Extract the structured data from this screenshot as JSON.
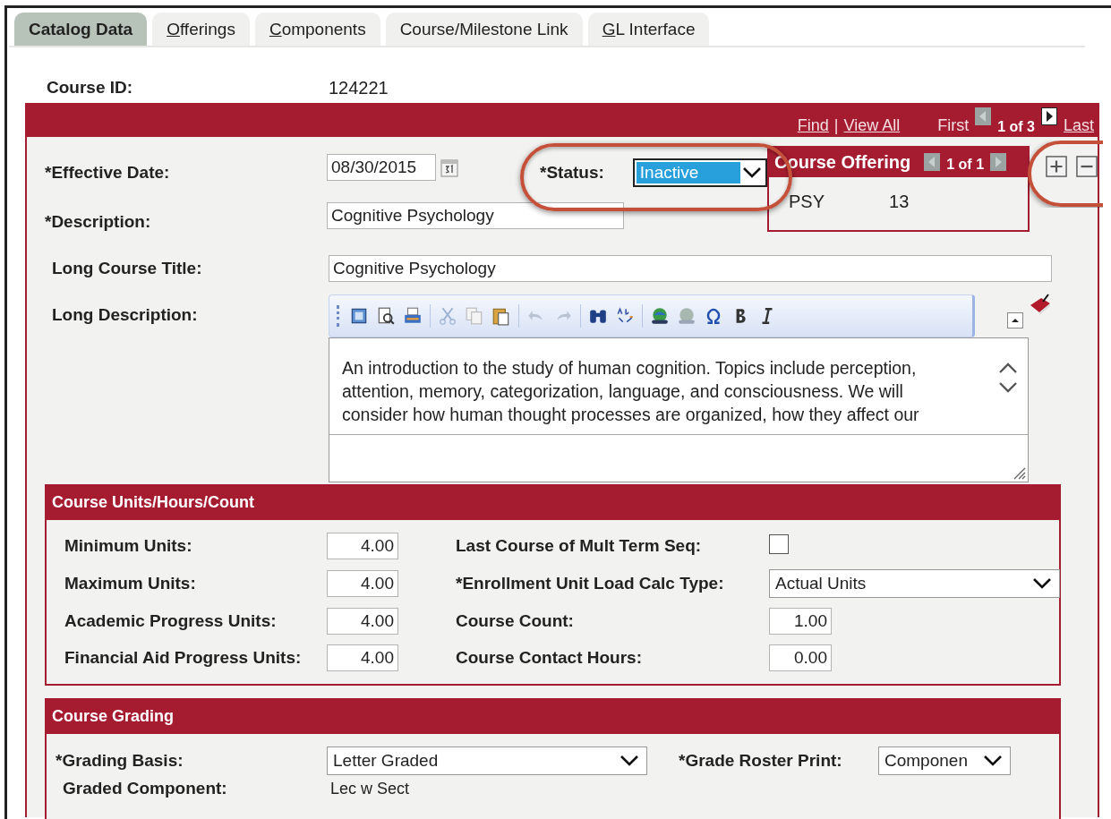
{
  "tabs": [
    {
      "label": "Catalog Data",
      "underline_first": false,
      "selected": true
    },
    {
      "label": "Offerings",
      "underline_first": true,
      "selected": false
    },
    {
      "label": "Components",
      "underline_first": true,
      "selected": false
    },
    {
      "label": "Course/Milestone Link",
      "underline_first": false,
      "selected": false
    },
    {
      "label": "GL Interface",
      "underline_first": true,
      "selected": false
    }
  ],
  "course_id": {
    "label": "Course ID:",
    "value": "124221"
  },
  "nav": {
    "find": "Find",
    "separator": "|",
    "view_all": "View All",
    "first": "First",
    "position": "1 of 3",
    "last": "Last"
  },
  "effective_date": {
    "label": "*Effective Date:",
    "value": "08/30/2015"
  },
  "status": {
    "label": "*Status:",
    "value": "Inactive",
    "circled": true
  },
  "course_offering": {
    "title": "Course Offering",
    "position": "1 of 1",
    "subject": "PSY",
    "number": "13"
  },
  "row_buttons": {
    "circled": true
  },
  "description": {
    "label": "*Description:",
    "value": "Cognitive Psychology"
  },
  "long_title": {
    "label": "Long Course Title:",
    "value": "Cognitive Psychology"
  },
  "long_description": {
    "label": "Long Description:",
    "text": "An introduction to the study of human cognition. Topics include perception, attention, memory, categorization, language, and consciousness. We will consider how human thought processes are organized, how they affect our"
  },
  "units": {
    "title": "Course Units/Hours/Count",
    "left": [
      {
        "label": "Minimum Units:",
        "value": "4.00"
      },
      {
        "label": "Maximum Units:",
        "value": "4.00"
      },
      {
        "label": "Academic Progress Units:",
        "value": "4.00"
      },
      {
        "label": "Financial Aid Progress Units:",
        "value": "4.00"
      }
    ],
    "right": [
      {
        "kind": "checkbox",
        "label": "Last Course of Mult Term Seq:",
        "checked": false
      },
      {
        "kind": "select",
        "label": "*Enrollment Unit Load Calc Type:",
        "value": "Actual Units"
      },
      {
        "kind": "number",
        "label": "Course Count:",
        "value": "1.00"
      },
      {
        "kind": "number",
        "label": "Course Contact Hours:",
        "value": "0.00"
      }
    ]
  },
  "grading": {
    "title": "Course Grading",
    "basis": {
      "label": "*Grading Basis:",
      "value": "Letter Graded"
    },
    "roster": {
      "label": "*Grade Roster Print:",
      "value": "Componen"
    },
    "component": {
      "label": "Graded Component:",
      "value": "Lec w Sect"
    }
  }
}
